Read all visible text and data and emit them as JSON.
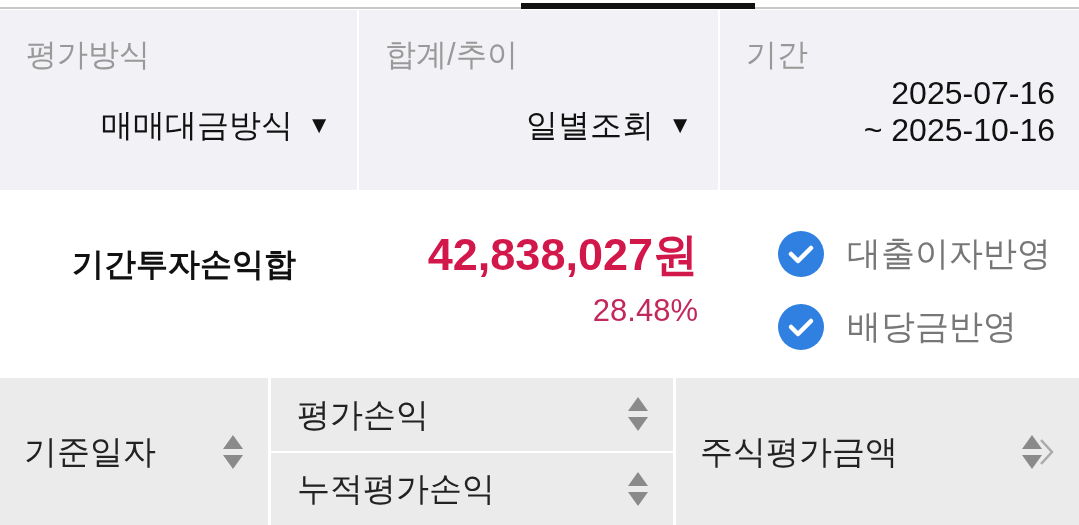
{
  "filters": [
    {
      "kind": "dropdown",
      "label": "평가방식",
      "value": "매매대금방식",
      "caret": "▼"
    },
    {
      "kind": "dropdown",
      "label": "합계/추이",
      "value": "일별조회",
      "caret": "▼"
    },
    {
      "kind": "period",
      "label": "기간",
      "lines": [
        "2025-07-16",
        "~ 2025-10-16"
      ]
    }
  ],
  "summary": {
    "label": "기간투자손익합",
    "amount": "42,838,027원",
    "rate": "28.48%",
    "options": [
      {
        "label": "대출이자반영",
        "checked": true
      },
      {
        "label": "배당금반영",
        "checked": true
      }
    ]
  },
  "table": {
    "columns": [
      {
        "kind": "single",
        "label": "기준일자"
      },
      {
        "kind": "stacked",
        "labels": [
          "평가손익",
          "누적평가손익"
        ]
      },
      {
        "kind": "single",
        "label": "주식평가금액",
        "more": true
      }
    ]
  }
}
